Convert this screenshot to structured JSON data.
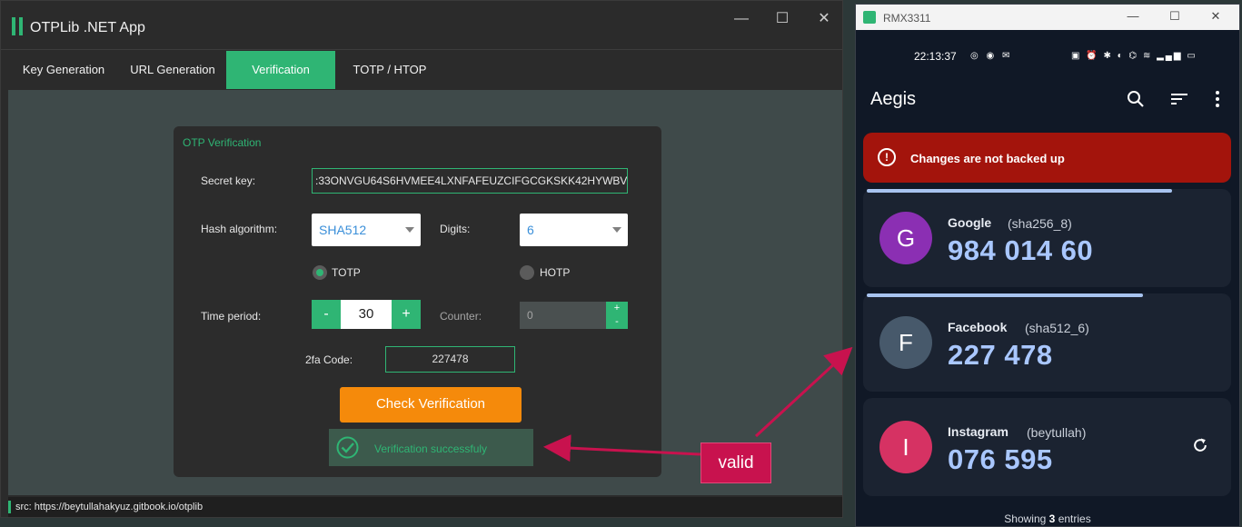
{
  "app": {
    "title": "OTPLib .NET App",
    "window_controls": {
      "minimize": "—",
      "maximize": "☐",
      "close": "✕"
    }
  },
  "tabs": [
    {
      "label": "Key Generation"
    },
    {
      "label": "URL Generation"
    },
    {
      "label": "Verification",
      "active": true
    },
    {
      "label": "TOTP / HTOP"
    }
  ],
  "verification": {
    "panel_title": "OTP Verification",
    "secret_label": "Secret key:",
    "secret_value": ":33ONVGU64S6HVMEE4LXNFAFEUZCIFGCGKSKK42HYWBV",
    "hash_label": "Hash algorithm:",
    "hash_value": "SHA512",
    "digits_label": "Digits:",
    "digits_value": "6",
    "totp_label": "TOTP",
    "hotp_label": "HOTP",
    "mode_selected": "TOTP",
    "time_period_label": "Time period:",
    "time_period_value": "30",
    "minus": "-",
    "plus": "+",
    "counter_label": "Counter:",
    "counter_value": "0",
    "code_label": "2fa Code:",
    "code_value": "227478",
    "check_button": "Check Verification",
    "result_text": "Verification successfuly"
  },
  "status_bar": {
    "text": "src: https://beytullahakyuz.gitbook.io/otplib"
  },
  "annotation": {
    "label": "valid"
  },
  "phone": {
    "window_title": "RMX3311",
    "status_time": "22:13:37",
    "app_title": "Aegis",
    "alert": "Changes are not backed up",
    "entries": [
      {
        "initial": "G",
        "issuer": "Google",
        "account": "(sha256_8)",
        "code": "984 014 60",
        "color": "#8b2fb3",
        "progress": 0.83
      },
      {
        "initial": "F",
        "issuer": "Facebook",
        "account": "(sha512_6)",
        "code": "227 478",
        "color": "#47596b",
        "progress": 0.75
      },
      {
        "initial": "I",
        "issuer": "Instagram",
        "account": "(beytullah)",
        "code": "076 595",
        "color": "#d63263"
      }
    ],
    "footer_prefix": "Showing",
    "footer_count": "3",
    "footer_suffix": "entries"
  },
  "colors": {
    "accent": "#2fb574",
    "orange": "#f58a0b",
    "alert": "#a3140c",
    "annotation": "#c8124e"
  }
}
